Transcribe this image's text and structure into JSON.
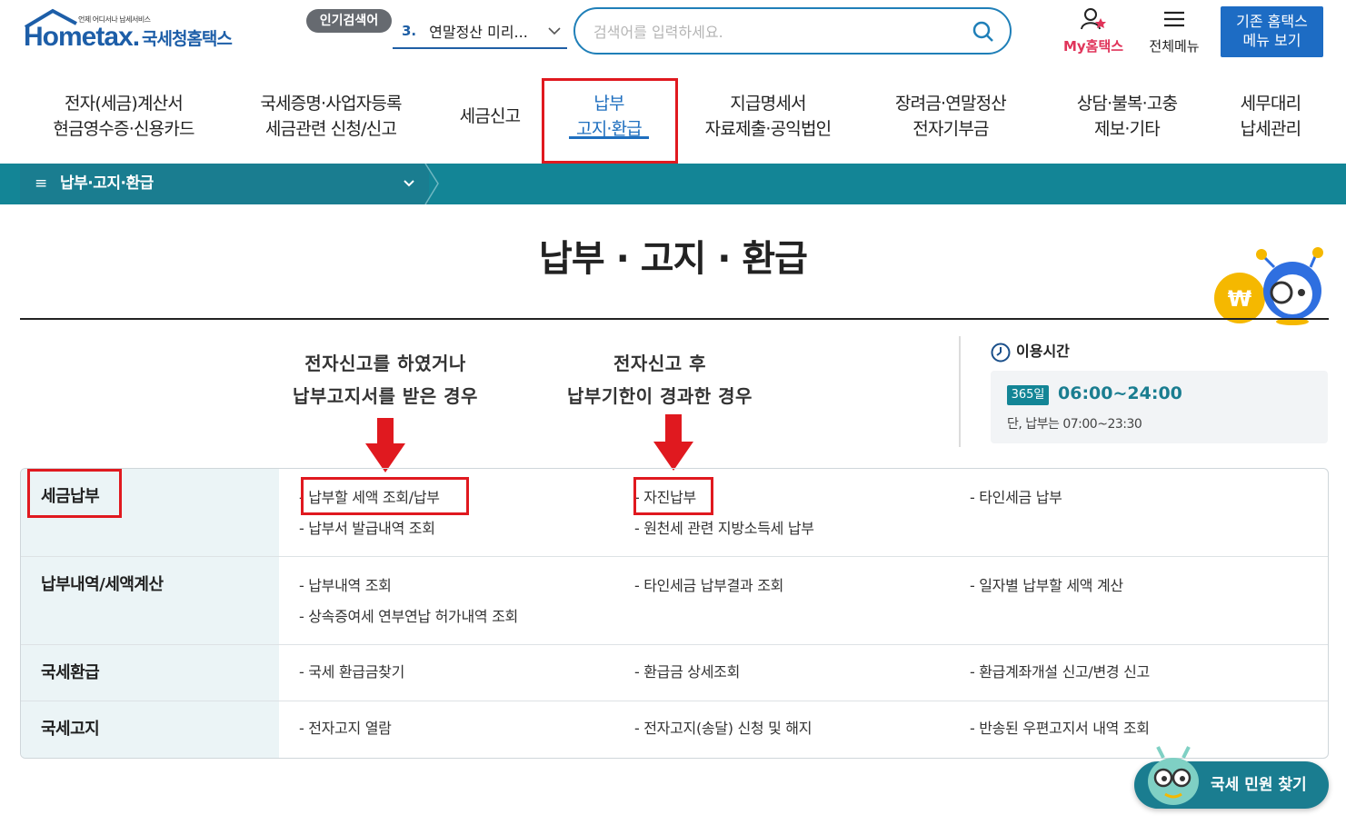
{
  "header": {
    "logo_brand": "Hometax.",
    "logo_kr": "국세청홈택스",
    "logo_tagline": "언제 어디서나 납세서비스",
    "popular_badge": "인기검색어",
    "popular_rank": "3.",
    "popular_keyword": "연말정산 미리...",
    "search_placeholder": "검색어를 입력하세요.",
    "my_hometax": "My홈택스",
    "all_menu": "전체메뉴",
    "legacy_button": "기존 홈택스\n메뉴 보기"
  },
  "gnb": {
    "items": [
      {
        "label": "전자(세금)계산서\n현금영수증·신용카드"
      },
      {
        "label": "국세증명·사업자등록\n세금관련 신청/신고"
      },
      {
        "label": "세금신고"
      },
      {
        "label": "납부\n고지·환급"
      },
      {
        "label": "지급명세서\n자료제출·공익법인"
      },
      {
        "label": "장려금·연말정산\n전자기부금"
      },
      {
        "label": "상담·불복·고충\n제보·기타"
      },
      {
        "label": "세무대리\n납세관리"
      }
    ],
    "active_index": 3
  },
  "path": {
    "current": "납부·고지·환급"
  },
  "page_title": "납부 · 고지 · 환급",
  "annotations": {
    "left": "전자신고를 하였거나\n납부고지서를 받은 경우",
    "right": "전자신고 후\n납부기한이 경과한 경우"
  },
  "usage": {
    "title": "이용시간",
    "badge": "365일",
    "hours": "06:00~24:00",
    "note": "단, 납부는 07:00~23:30"
  },
  "table": {
    "rows": [
      {
        "head": "세금납부",
        "cols": [
          [
            "- 납부할 세액 조회/납부",
            "- 납부서 발급내역 조회"
          ],
          [
            "- 자진납부",
            "- 원천세 관련 지방소득세 납부"
          ],
          [
            "- 타인세금 납부"
          ]
        ]
      },
      {
        "head": "납부내역/세액계산",
        "cols": [
          [
            "- 납부내역 조회",
            "- 상속증여세 연부연납 허가내역 조회"
          ],
          [
            "- 타인세금 납부결과 조회"
          ],
          [
            "- 일자별 납부할 세액 계산"
          ]
        ]
      },
      {
        "head": "국세환급",
        "cols": [
          [
            "- 국세 환급금찾기"
          ],
          [
            "- 환급금 상세조회"
          ],
          [
            "- 환급계좌개설 신고/변경 신고"
          ]
        ]
      },
      {
        "head": "국세고지",
        "cols": [
          [
            "- 전자고지 열람"
          ],
          [
            "- 전자고지(송달) 신청 및 해지"
          ],
          [
            "- 반송된 우편고지서 내역 조회"
          ]
        ]
      }
    ]
  },
  "float_button": "국세 민원 찾기",
  "colors": {
    "primary": "#1f6fbf",
    "teal": "#138596",
    "highlight": "#e0191f",
    "row_head_bg": "#ebf4f6"
  }
}
